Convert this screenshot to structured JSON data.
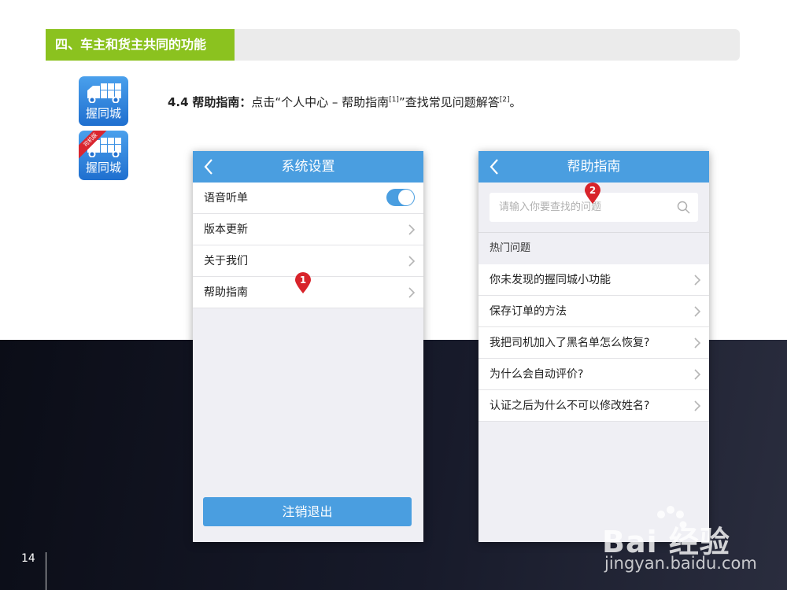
{
  "section": {
    "title": "四、车主和货主共同的功能"
  },
  "app_icons": [
    {
      "name": "握同城",
      "badge": ""
    },
    {
      "name": "握同城",
      "badge": "司机版"
    }
  ],
  "instruction": {
    "number": "4.4",
    "heading": "帮助指南：",
    "text_before": "点击“个人中心 – 帮助指南",
    "ref1": "[1]",
    "text_mid": "”查找常见问题解答",
    "ref2": "[2]",
    "text_end": "。"
  },
  "screen_settings": {
    "title": "系统设置",
    "rows": [
      {
        "label": "语音听单",
        "toggle_on": true
      },
      {
        "label": "版本更新"
      },
      {
        "label": "关于我们"
      },
      {
        "label": "帮助指南"
      }
    ],
    "logout_label": "注销退出",
    "marker": "1"
  },
  "screen_help": {
    "title": "帮助指南",
    "search_placeholder": "请输入你要查找的问题",
    "section_label": "热门问题",
    "questions": [
      "你未发现的握同城小功能",
      "保存订单的方法",
      "我把司机加入了黑名单怎么恢复?",
      "为什么会自动评价?",
      "认证之后为什么不可以修改姓名?"
    ],
    "marker": "2"
  },
  "footer": {
    "page_number": "14"
  },
  "watermark": {
    "logo": "Bai 经验",
    "url": "jingyan.baidu.com"
  },
  "colors": {
    "accent_green": "#8bc21f",
    "nav_blue": "#4a9ee0",
    "marker_red": "#d8232a"
  }
}
